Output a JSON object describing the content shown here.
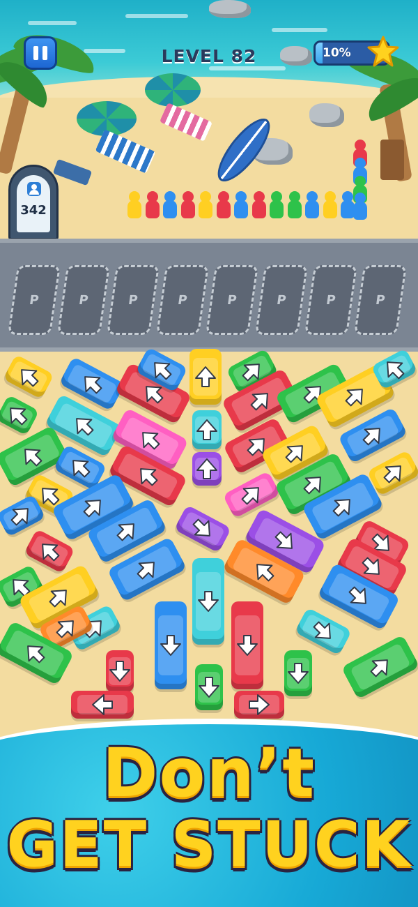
{
  "hud": {
    "pause_icon": "pause-icon",
    "level_label": "LEVEL 82",
    "progress_text": "10%",
    "progress_value": 0.1,
    "star_icon": "star-icon"
  },
  "counter": {
    "icon": "passenger-icon",
    "value": "342"
  },
  "parking": {
    "slot_label": "P",
    "slot_count": 8
  },
  "queue": {
    "colors": [
      "yellow",
      "red",
      "blue",
      "red",
      "yellow",
      "red",
      "blue",
      "red",
      "green",
      "green",
      "blue",
      "yellow",
      "blue"
    ]
  },
  "colors": {
    "red": "#e8394a",
    "blue": "#2e8ff0",
    "green": "#2ec24a",
    "yellow": "#ffcf22",
    "cyan": "#3fd0db",
    "pink": "#ff5fc2",
    "purple": "#9b4fe6",
    "orange": "#ff8a2a",
    "arrow": "#ffffff"
  },
  "vehicles": [
    {
      "color": "yellow",
      "dir": "up-left"
    },
    {
      "color": "blue",
      "dir": "up-left"
    },
    {
      "color": "red",
      "dir": "up-left"
    },
    {
      "color": "blue",
      "dir": "up-left"
    },
    {
      "color": "yellow",
      "dir": "up"
    },
    {
      "color": "green",
      "dir": "up-right"
    },
    {
      "color": "red",
      "dir": "up-right"
    },
    {
      "color": "green",
      "dir": "up-right"
    },
    {
      "color": "yellow",
      "dir": "up-right"
    },
    {
      "color": "cyan",
      "dir": "up-left"
    },
    {
      "color": "green",
      "dir": "up-left"
    },
    {
      "color": "cyan",
      "dir": "up-left"
    },
    {
      "color": "pink",
      "dir": "up-left"
    },
    {
      "color": "cyan",
      "dir": "up"
    },
    {
      "color": "red",
      "dir": "up-right"
    },
    {
      "color": "yellow",
      "dir": "up-right"
    },
    {
      "color": "blue",
      "dir": "up-right"
    },
    {
      "color": "green",
      "dir": "up-left"
    },
    {
      "color": "blue",
      "dir": "up-left"
    },
    {
      "color": "red",
      "dir": "up-left"
    },
    {
      "color": "purple",
      "dir": "up"
    },
    {
      "color": "pink",
      "dir": "up-right"
    },
    {
      "color": "green",
      "dir": "up-right"
    },
    {
      "color": "yellow",
      "dir": "up-right"
    },
    {
      "color": "yellow",
      "dir": "up-left"
    },
    {
      "color": "blue",
      "dir": "up-right"
    },
    {
      "color": "blue",
      "dir": "up-right"
    },
    {
      "color": "purple",
      "dir": "down-right"
    },
    {
      "color": "blue",
      "dir": "up-right"
    },
    {
      "color": "blue",
      "dir": "up-right"
    },
    {
      "color": "red",
      "dir": "up-left"
    },
    {
      "color": "blue",
      "dir": "up-right"
    },
    {
      "color": "purple",
      "dir": "down-right"
    },
    {
      "color": "orange",
      "dir": "up-left"
    },
    {
      "color": "red",
      "dir": "down-right"
    },
    {
      "color": "red",
      "dir": "down-right"
    },
    {
      "color": "green",
      "dir": "up-left"
    },
    {
      "color": "yellow",
      "dir": "up-right"
    },
    {
      "color": "cyan",
      "dir": "up-right"
    },
    {
      "color": "cyan",
      "dir": "down"
    },
    {
      "color": "blue",
      "dir": "down-right"
    },
    {
      "color": "orange",
      "dir": "up-right"
    },
    {
      "color": "blue",
      "dir": "down"
    },
    {
      "color": "red",
      "dir": "down"
    },
    {
      "color": "cyan",
      "dir": "down-right"
    },
    {
      "color": "green",
      "dir": "up-left"
    },
    {
      "color": "red",
      "dir": "down"
    },
    {
      "color": "green",
      "dir": "down"
    },
    {
      "color": "green",
      "dir": "down"
    },
    {
      "color": "green",
      "dir": "up-right"
    },
    {
      "color": "red",
      "dir": "left"
    },
    {
      "color": "red",
      "dir": "right"
    }
  ],
  "banner": {
    "line1": "Don’t",
    "line2": "GET STUCK"
  }
}
